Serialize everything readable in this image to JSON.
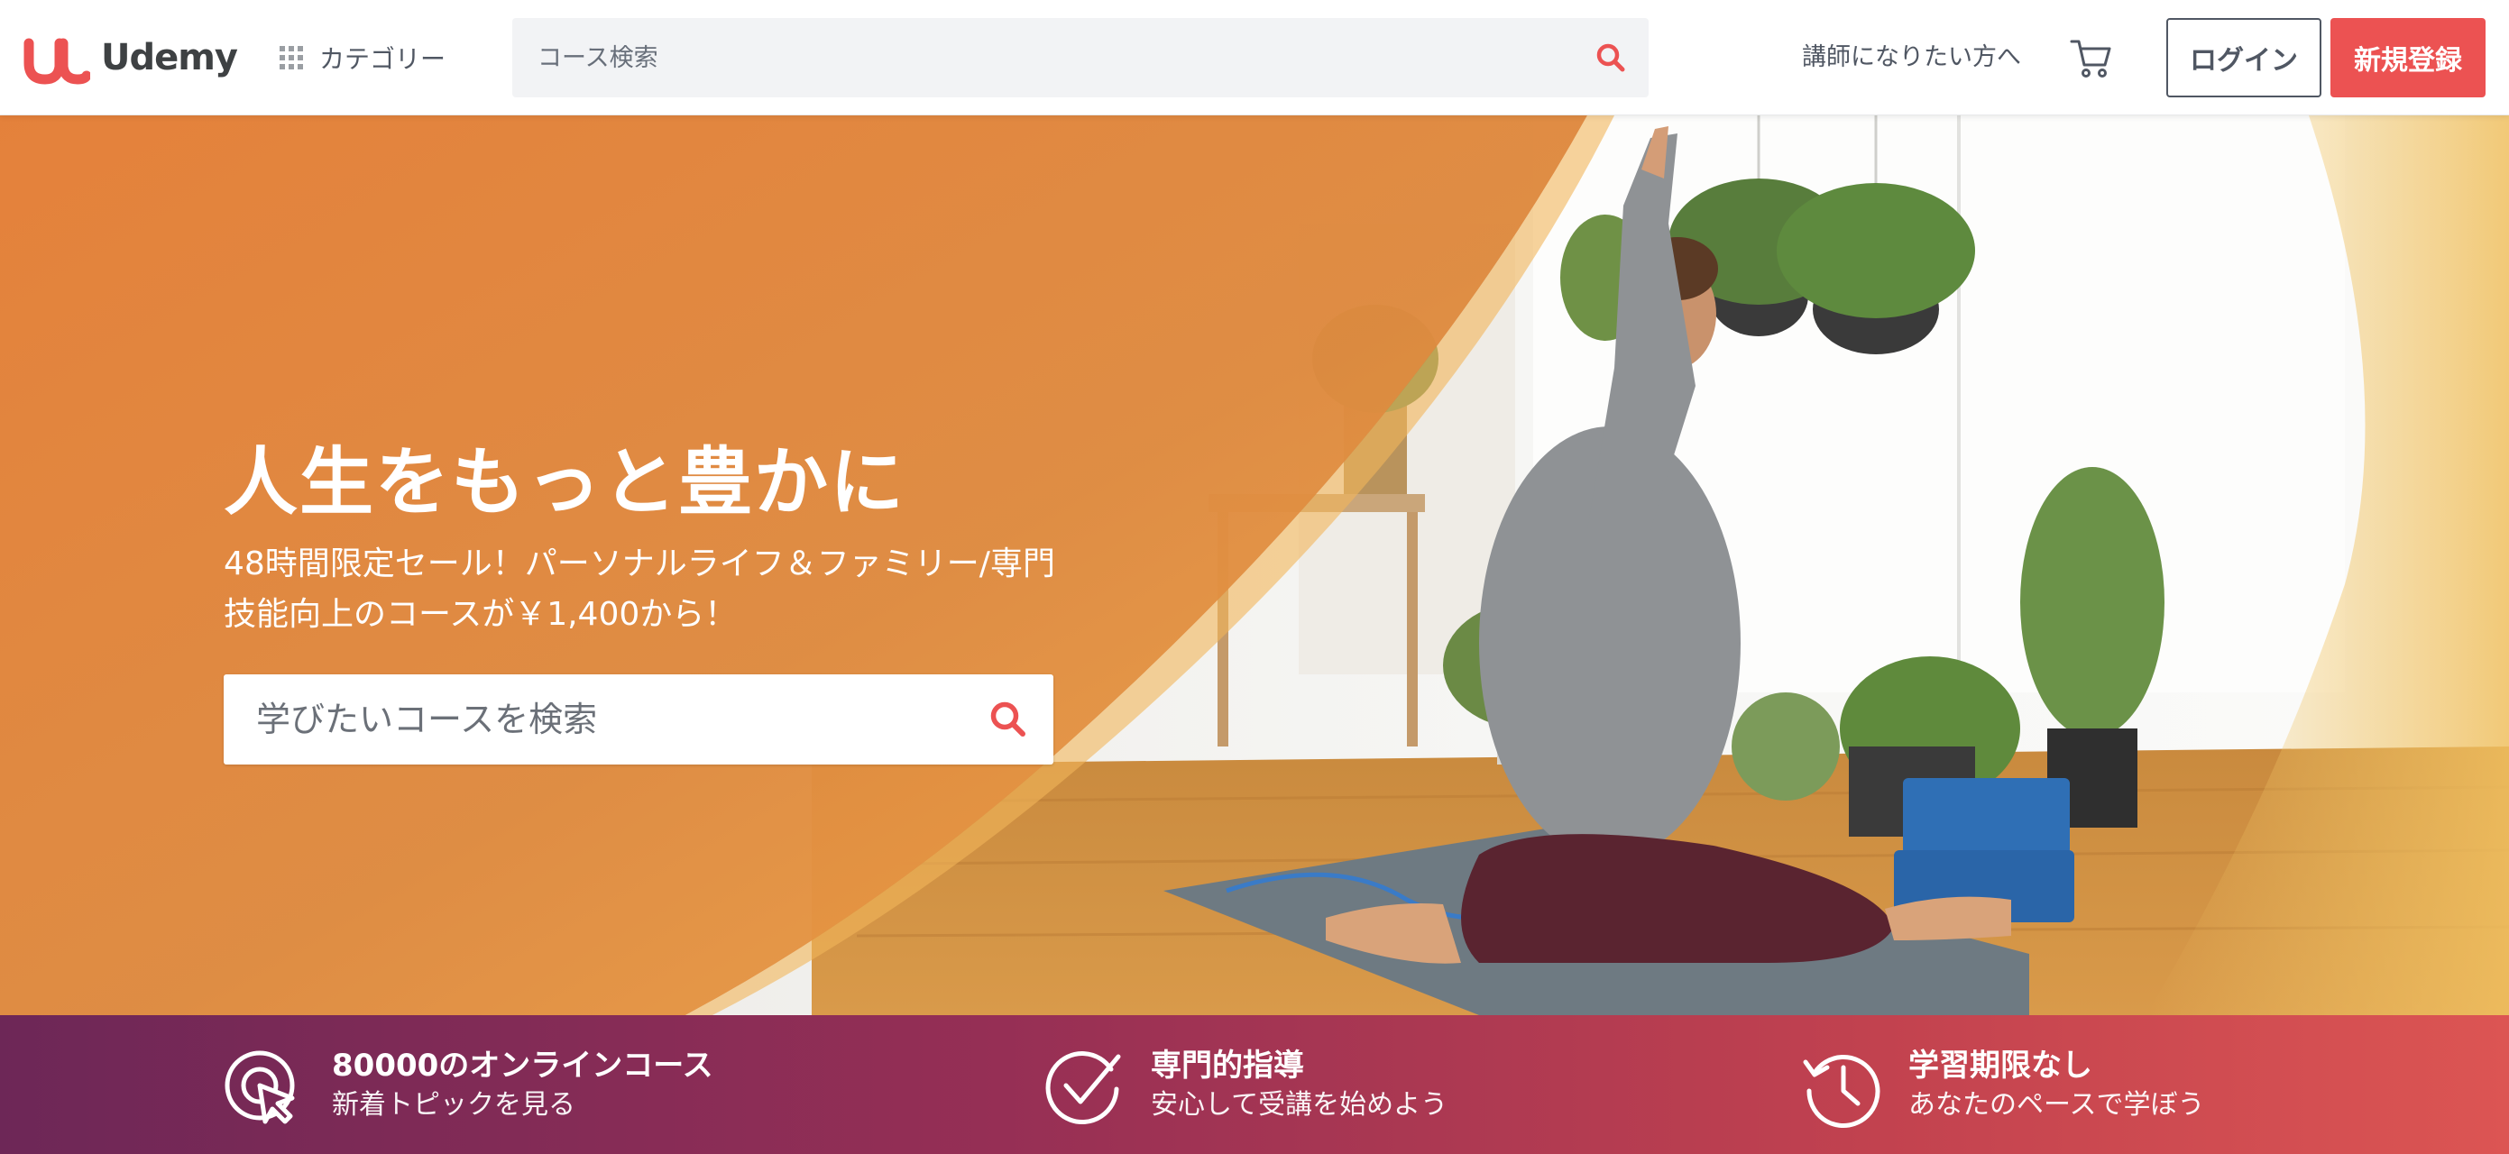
{
  "header": {
    "logo_text": "Udemy",
    "categories_label": "カテゴリー",
    "search_placeholder": "コース検索",
    "teach_label": "講師になりたい方へ",
    "login_label": "ログイン",
    "signup_label": "新規登録",
    "icons": [
      "udemy-logo-icon",
      "grid-icon",
      "search-icon",
      "cart-icon"
    ]
  },
  "hero": {
    "title": "人生をもっと豊かに",
    "subtitle_line1": "48時間限定セール！パーソナルライフ＆ファミリー/専門",
    "subtitle_line2": "技能向上のコースが￥1,400から！",
    "search_placeholder": "学びたいコースを検索"
  },
  "features": [
    {
      "title": "80000のオンラインコース",
      "desc": "新着トピックを見る",
      "icon": "cursor-click-icon"
    },
    {
      "title": "専門的指導",
      "desc": "安心して受講を始めよう",
      "icon": "checkmark-circle-icon"
    },
    {
      "title": "学習期限なし",
      "desc": "あなたのペースで学ぼう",
      "icon": "clock-history-icon"
    }
  ],
  "colors": {
    "brand_red": "#ec5252",
    "hero_orange": "#e07a33",
    "feature_bar_start": "#6d2757",
    "feature_bar_end": "#dc5553"
  }
}
